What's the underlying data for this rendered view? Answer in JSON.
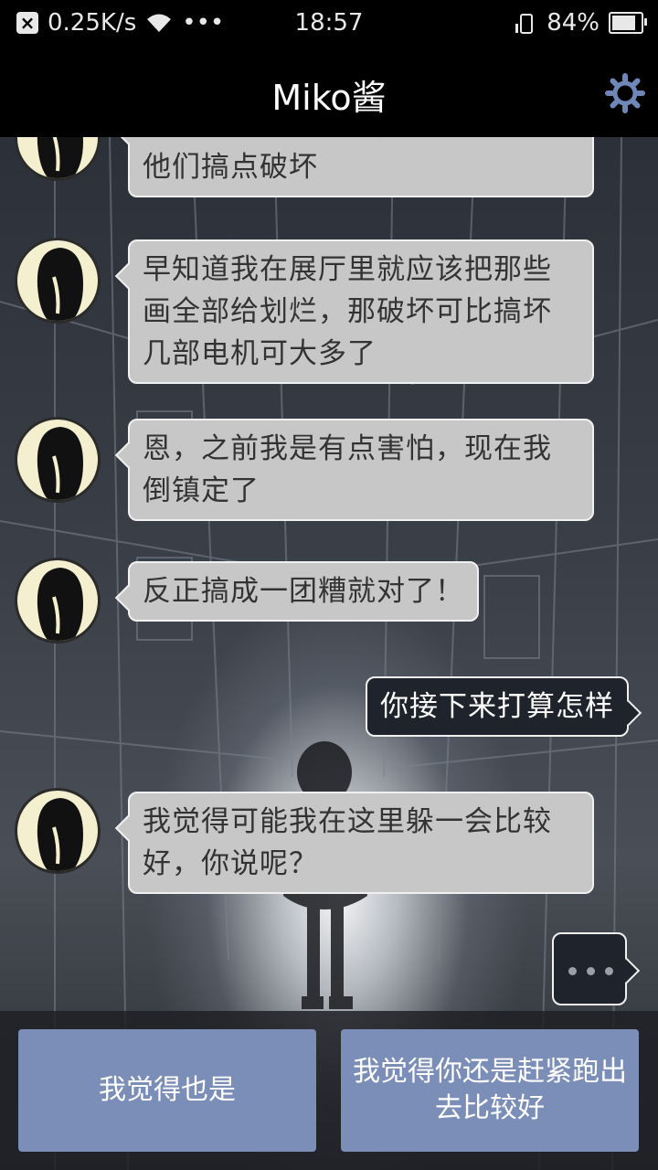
{
  "status_bar": {
    "speed": "0.25K/s",
    "more": "•••",
    "time": "18:57",
    "battery": "84%",
    "battery_level": 0.84
  },
  "header": {
    "title": "Miko酱"
  },
  "messages": [
    {
      "from": "miko",
      "text": "他们把我也抓起来，我就应该给他们搞点破坏"
    },
    {
      "from": "miko",
      "text": "早知道我在展厅里就应该把那些画全部给划烂，那破坏可比搞坏几部电机可大多了"
    },
    {
      "from": "miko",
      "text": "恩，之前我是有点害怕，现在我倒镇定了"
    },
    {
      "from": "miko",
      "text": "反正搞成一团糟就对了！"
    },
    {
      "from": "user",
      "text": "你接下来打算怎样"
    },
    {
      "from": "miko",
      "text": "我觉得可能我在这里躲一会比较好，你说呢？"
    }
  ],
  "options": [
    {
      "label": "我觉得也是"
    },
    {
      "label": "我觉得你还是赶紧跑出去比较好"
    }
  ],
  "colors": {
    "bubble_other": "#c7c7c7",
    "bubble_user": "#1f232b",
    "option_button": "#7b8eb8",
    "gear_icon": "#6f87b8"
  }
}
